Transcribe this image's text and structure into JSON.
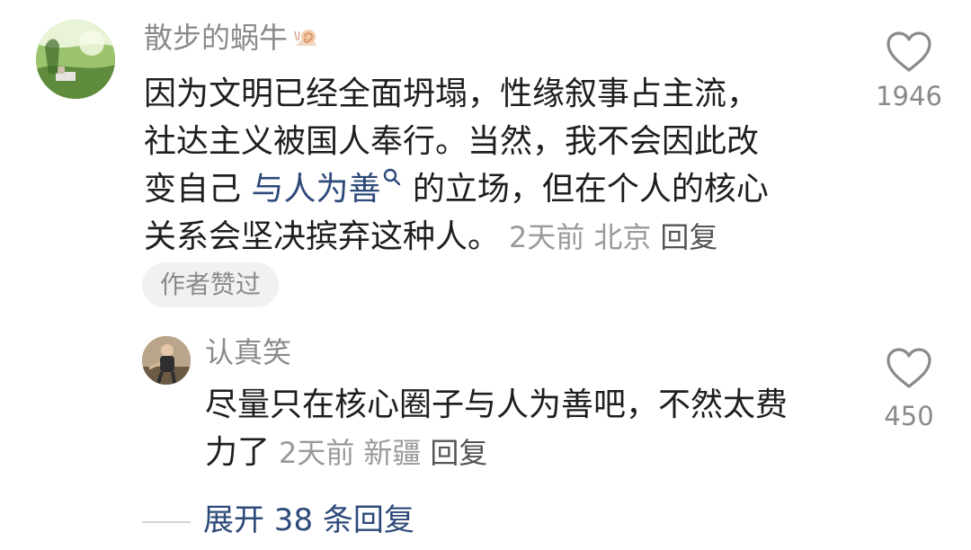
{
  "main_comment": {
    "username": "散步的蜗牛",
    "user_badge_icon": "snail-icon",
    "text_line1": "因为文明已经全面坍塌，性缘叙事占主流，",
    "text_line2": "社达主义被国人奉行。当然，我不会因此改",
    "text_line3_prefix": "变自己 ",
    "text_line3_link": "与人为善",
    "text_line3_suffix": " 的立场，但在个人的核心",
    "text_line4": "关系会坚决摈弃这种人。",
    "time": "2天前",
    "location": "北京",
    "reply_label": "回复",
    "author_liked_label": "作者赞过",
    "like_count": "1946",
    "like_icon": "heart-outline-icon"
  },
  "reply_comment": {
    "username": "认真笑",
    "text_line1": "尽量只在核心圈子与人为善吧，不然太费",
    "text_line2": "力了",
    "time": "2天前",
    "location": "新疆",
    "reply_label": "回复",
    "like_count": "450",
    "like_icon": "heart-outline-icon"
  },
  "expand_replies_label": "展开 38 条回复",
  "colors": {
    "link": "#2d4a7a",
    "meta_gray": "#9a9a9a",
    "text": "#1e1e1e"
  }
}
